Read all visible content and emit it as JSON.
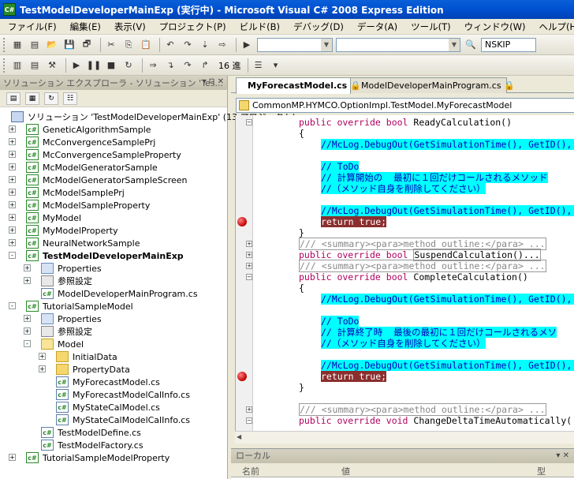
{
  "window": {
    "title": "TestModelDeveloperMainExp (実行中) - Microsoft Visual C# 2008 Express Edition",
    "icon_label": "C#"
  },
  "menu": [
    "ファイル(F)",
    "編集(E)",
    "表示(V)",
    "プロジェクト(P)",
    "ビルド(B)",
    "デバッグ(D)",
    "データ(A)",
    "ツール(T)",
    "ウィンドウ(W)",
    "ヘルプ(H)"
  ],
  "toolbar": {
    "search_value": "NSKIP",
    "radix_label": "16 進"
  },
  "solution_explorer": {
    "title": "ソリューション エクスプローラ - ソリューション 'Tes...",
    "controls": "▾ ⊓ ✕",
    "items": [
      {
        "label": "ソリューション 'TestModelDeveloperMainExp' (13 プロジェクト)"
      },
      {
        "label": "GeneticAlgorithmSample"
      },
      {
        "label": "McConvergenceSamplePrj"
      },
      {
        "label": "McConvergenceSampleProperty"
      },
      {
        "label": "McModelGeneratorSample"
      },
      {
        "label": "McModelGeneratorSampleScreen"
      },
      {
        "label": "McModelSamplePrj"
      },
      {
        "label": "McModelSampleProperty"
      },
      {
        "label": "MyModel"
      },
      {
        "label": "MyModelProperty"
      },
      {
        "label": "NeuralNetworkSample"
      },
      {
        "label": "TestModelDeveloperMainExp"
      },
      {
        "label": "Properties"
      },
      {
        "label": "参照設定"
      },
      {
        "label": "ModelDeveloperMainProgram.cs"
      },
      {
        "label": "TutorialSampleModel"
      },
      {
        "label": "Properties"
      },
      {
        "label": "参照設定"
      },
      {
        "label": "Model"
      },
      {
        "label": "InitialData"
      },
      {
        "label": "PropertyData"
      },
      {
        "label": "MyForecastModel.cs"
      },
      {
        "label": "MyForecastModelCalInfo.cs"
      },
      {
        "label": "MyStateCalModel.cs"
      },
      {
        "label": "MyStateCalModelCalInfo.cs"
      },
      {
        "label": "TestModelDefine.cs"
      },
      {
        "label": "TestModelFactory.cs"
      },
      {
        "label": "TutorialSampleModelProperty"
      }
    ]
  },
  "tabs": [
    {
      "label": "MyForecastModel.cs"
    },
    {
      "label": "ModelDeveloperMainProgram.cs"
    }
  ],
  "editor": {
    "type_path": "CommonMP.HYMCO.OptionImpl.TestModel.MyForecastModel",
    "lines": [
      {
        "kw": "public override bool ",
        "text": "ReadyCalculation()"
      },
      {
        "text": "{"
      },
      {
        "text": "//McLog.DebugOut(GetSimulationTime(), GetID(), "
      },
      {
        "text": "// ToDo"
      },
      {
        "text": "// 計算開始の  最初に１回だけコールされるメソッド"
      },
      {
        "text": "//（メソッド自身を削除してください）"
      },
      {
        "text": "//McLog.DebugOut(GetSimulationTime(), GetID(), "
      },
      {
        "text": "return true;"
      },
      {
        "text": "}"
      },
      {
        "text": "/// <summary><para>method outline:</para> ..."
      },
      {
        "kw": "public override bool ",
        "text": "SuspendCalculation()..."
      },
      {
        "text": "/// <summary><para>method outline:</para> ..."
      },
      {
        "kw": "public override bool ",
        "text": "CompleteCalculation()"
      },
      {
        "text": "{"
      },
      {
        "text": "//McLog.DebugOut(GetSimulationTime(), GetID(), "
      },
      {
        "text": "// ToDo"
      },
      {
        "text": "// 計算終了時  最後の最初に１回だけコールされるメソ"
      },
      {
        "text": "//（メソッド自身を削除してください）"
      },
      {
        "text": "//McLog.DebugOut(GetSimulationTime(), GetID(), "
      },
      {
        "text": "return true;"
      },
      {
        "text": "}"
      },
      {
        "text": "/// <summary><para>method outline:</para> ..."
      },
      {
        "kw": "public override void ",
        "text": "ChangeDeltaTimeAutomatically("
      }
    ]
  },
  "locals": {
    "title": "ローカル",
    "controls": "▾ ✕",
    "col_name": "名前",
    "col_value": "値",
    "col_type": "型"
  },
  "colors": {
    "highlight": "#00ffff",
    "breakpoint_line": "#8b2e2e",
    "keyword": "#b00060",
    "comment": "#0000b8"
  }
}
